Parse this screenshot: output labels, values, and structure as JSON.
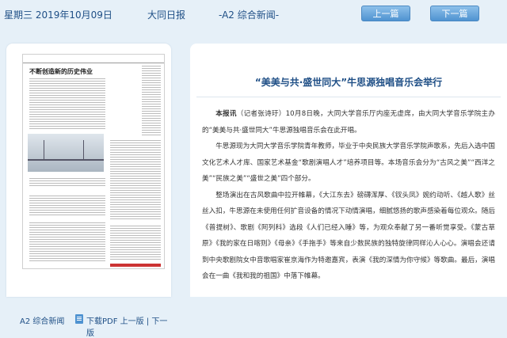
{
  "header": {
    "date": "星期三 2019年10月09日",
    "newspaper": "大同日报",
    "section": "-A2 综合新闻-",
    "prev_label": "上一篇",
    "next_label": "下一篇"
  },
  "thumbnail": {
    "headline": "不断创造新的历史伟业",
    "caption": "A2 综合新闻",
    "pdf_label": "下载PDF",
    "prev_page": "上一版",
    "separator": "|",
    "next_page": "下一版"
  },
  "article": {
    "title": "“美美与共·盛世同大”牛思源独唱音乐会举行",
    "lead": "本报讯",
    "paragraphs": [
      "（记者张诗玗）10月8日晚，大同大学音乐厅内座无虚席，由大同大学音乐学院主办的“美美与共·盛世同大”牛思源独唱音乐会在此开唱。",
      "牛思源现为大同大学音乐学院青年教师，毕业于中央民族大学音乐学院声歌系，先后入选中国文化艺术人才库、国家艺术基金“歌剧演唱人才”培养项目等。本场音乐会分为“古风之美”“西洋之美”“民族之美”“盛世之美”四个部分。",
      "整场演出在古风歌曲中拉开帷幕，《大江东去》磅礴浑厚、《钗头凤》婉约动听、《越人歌》丝丝入扣，牛思源在未使用任何扩音设备的情况下动情演唱，细腻悠扬的歌声感染着每位观众。随后《普提树》、歌剧《阿列科》选段《人们已经入睡》等，为观众奉献了另一番听觉享受。《蒙古草原》《我的家在日喀则》《母亲》《手拖手》等来自少数民族的独特旋律同样沁人心心。演唱会还请到中央歌剧院女中音歌唱家崔京海作为特邀嘉宾，表演《我的深情为你守候》等歌曲。最后，演唱会在一曲《我和我的祖国》中落下帷幕。"
    ]
  }
}
